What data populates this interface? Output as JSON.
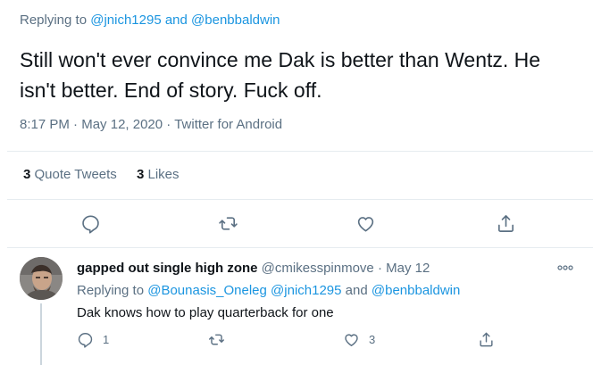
{
  "main_tweet": {
    "replying_prefix": "Replying to",
    "replying_user1": "@jnich1295",
    "replying_and": "and",
    "replying_user2": "@benbbaldwin",
    "text": "Still won't ever convince me Dak is better than Wentz. He isn't better. End of story. Fuck off.",
    "time": "8:17 PM",
    "dot1": "·",
    "date": "May 12, 2020",
    "dot2": "·",
    "source": "Twitter for Android",
    "quote_count": "3",
    "quote_label": "Quote Tweets",
    "likes_count": "3",
    "likes_label": "Likes",
    "actions": [
      "reply-icon",
      "retweet-icon",
      "like-icon",
      "share-icon"
    ]
  },
  "reply": {
    "display_name": "gapped out single high zone",
    "handle": "@cmikesspinmove",
    "dot": "·",
    "date": "May 12",
    "replying_prefix": "Replying to",
    "replying_user1": "@Bounasis_Oneleg",
    "replying_user2": "@jnich1295",
    "replying_and": "and",
    "replying_user3": "@benbbaldwin",
    "text": "Dak knows how to play quarterback for one",
    "reply_count": "1",
    "retweet_count": "",
    "like_count": "3",
    "more_icon": "more-icon"
  },
  "colors": {
    "link": "#1b95e0",
    "muted": "#5b7083",
    "text": "#0f1419",
    "divider": "#e6ecf0"
  }
}
